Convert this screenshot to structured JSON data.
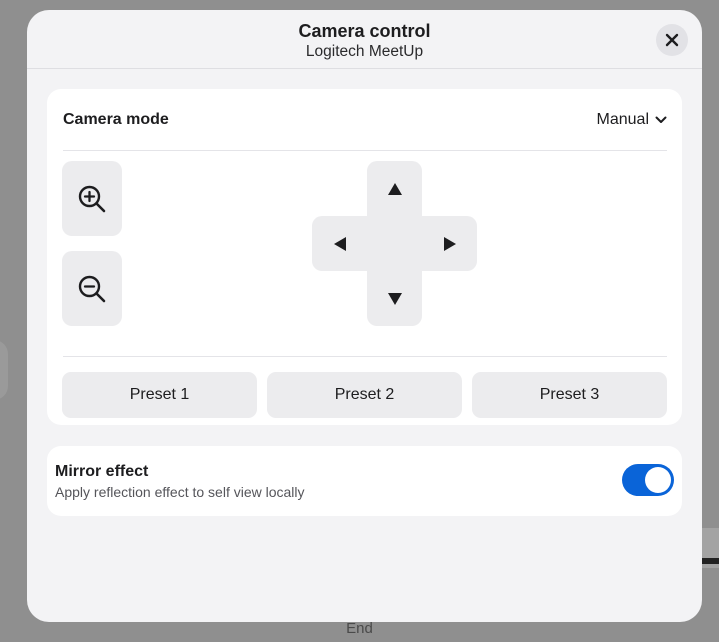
{
  "dialog": {
    "title": "Camera control",
    "subtitle": "Logitech MeetUp"
  },
  "camera": {
    "mode_label": "Camera mode",
    "mode_value": "Manual",
    "presets": [
      "Preset 1",
      "Preset 2",
      "Preset 3"
    ]
  },
  "mirror": {
    "title": "Mirror effect",
    "description": "Apply reflection effect to self view locally",
    "enabled": true
  },
  "backdrop": {
    "end_label": "End"
  },
  "colors": {
    "accent": "#0a64d8",
    "dialog_bg": "#f3f3f5",
    "button_bg": "#ececee"
  },
  "icons": {
    "close": "close-icon",
    "chevron": "chevron-down-icon",
    "zoom_in": "zoom-in-icon",
    "zoom_out": "zoom-out-icon",
    "up": "arrow-up-icon",
    "down": "arrow-down-icon",
    "left": "arrow-left-icon",
    "right": "arrow-right-icon"
  }
}
